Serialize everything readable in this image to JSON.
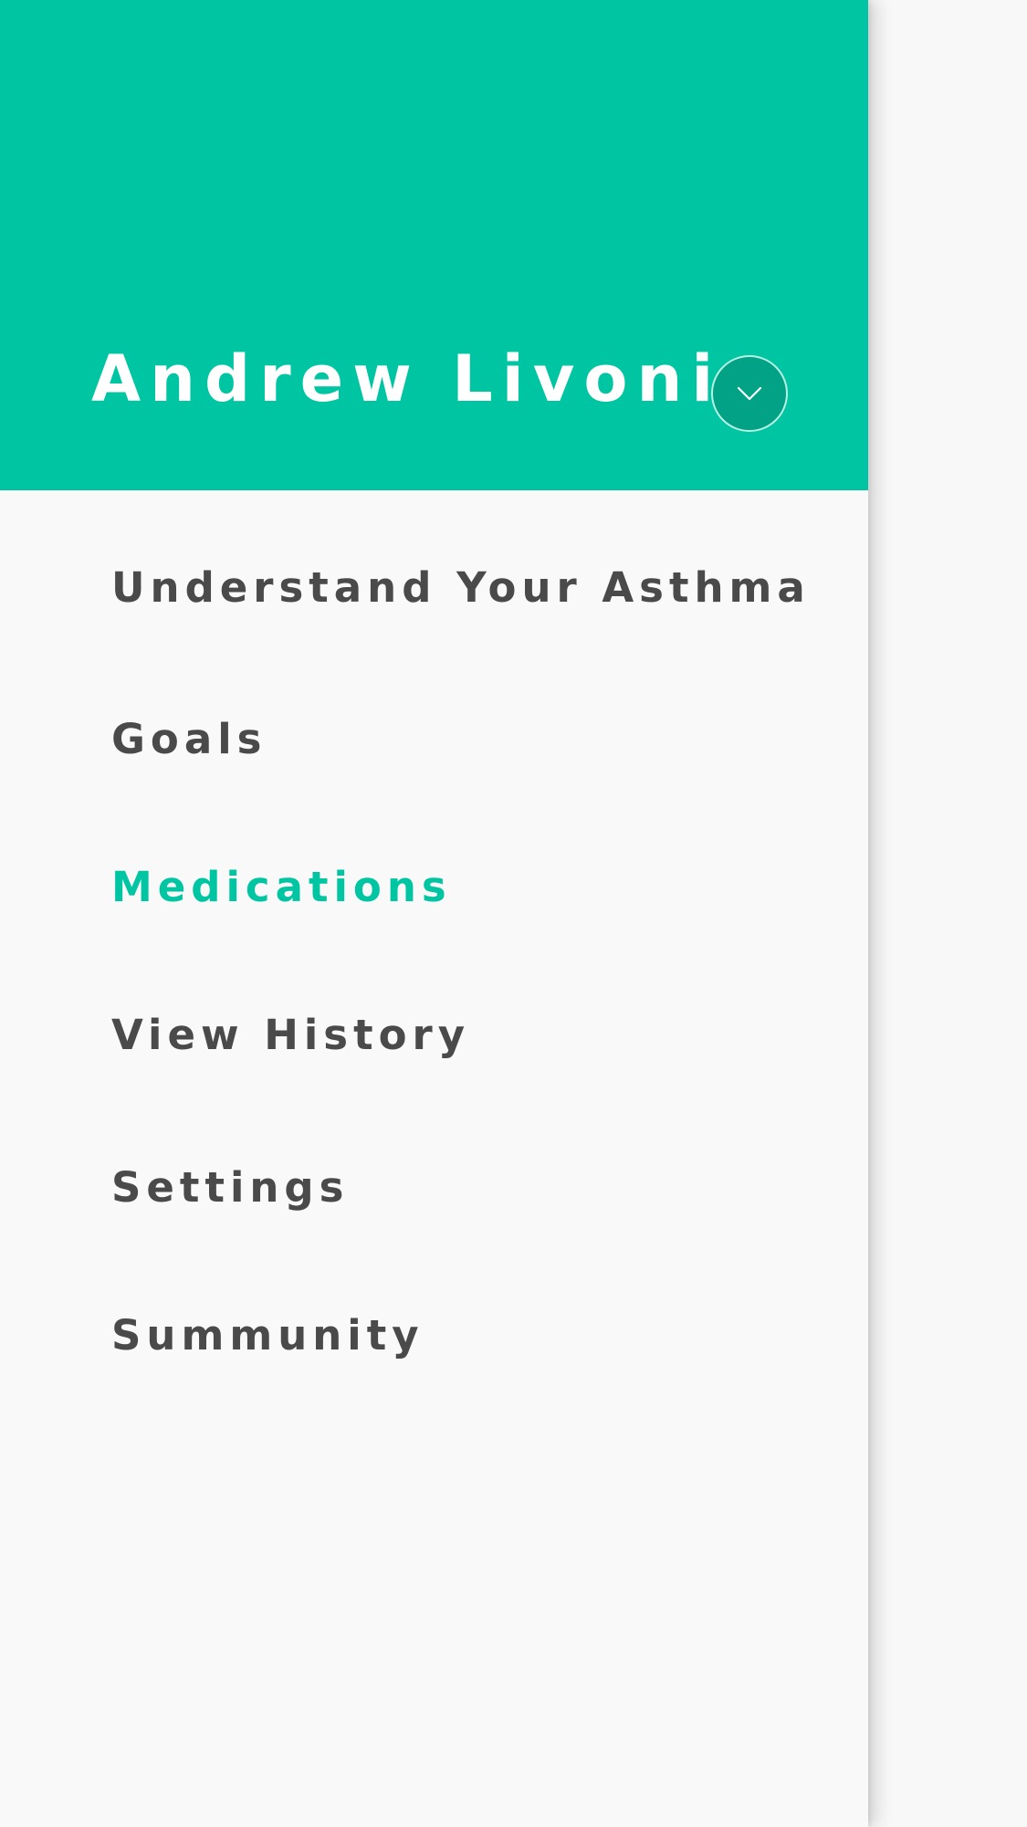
{
  "colors": {
    "accent": "#00c5a2",
    "accent_dark": "#01a286",
    "text": "#4a4a4a",
    "drawer_bg": "#f9f9f9"
  },
  "header": {
    "user_name": "Andrew Livoni",
    "toggle_icon": "chevron-down-icon"
  },
  "menu": {
    "active_item": "Medications",
    "items": [
      {
        "label": "Understand Your Asthma"
      },
      {
        "label": "Goals"
      },
      {
        "label": "Medications"
      },
      {
        "label": "View History"
      },
      {
        "label": "Settings"
      },
      {
        "label": "Summunity"
      }
    ]
  }
}
